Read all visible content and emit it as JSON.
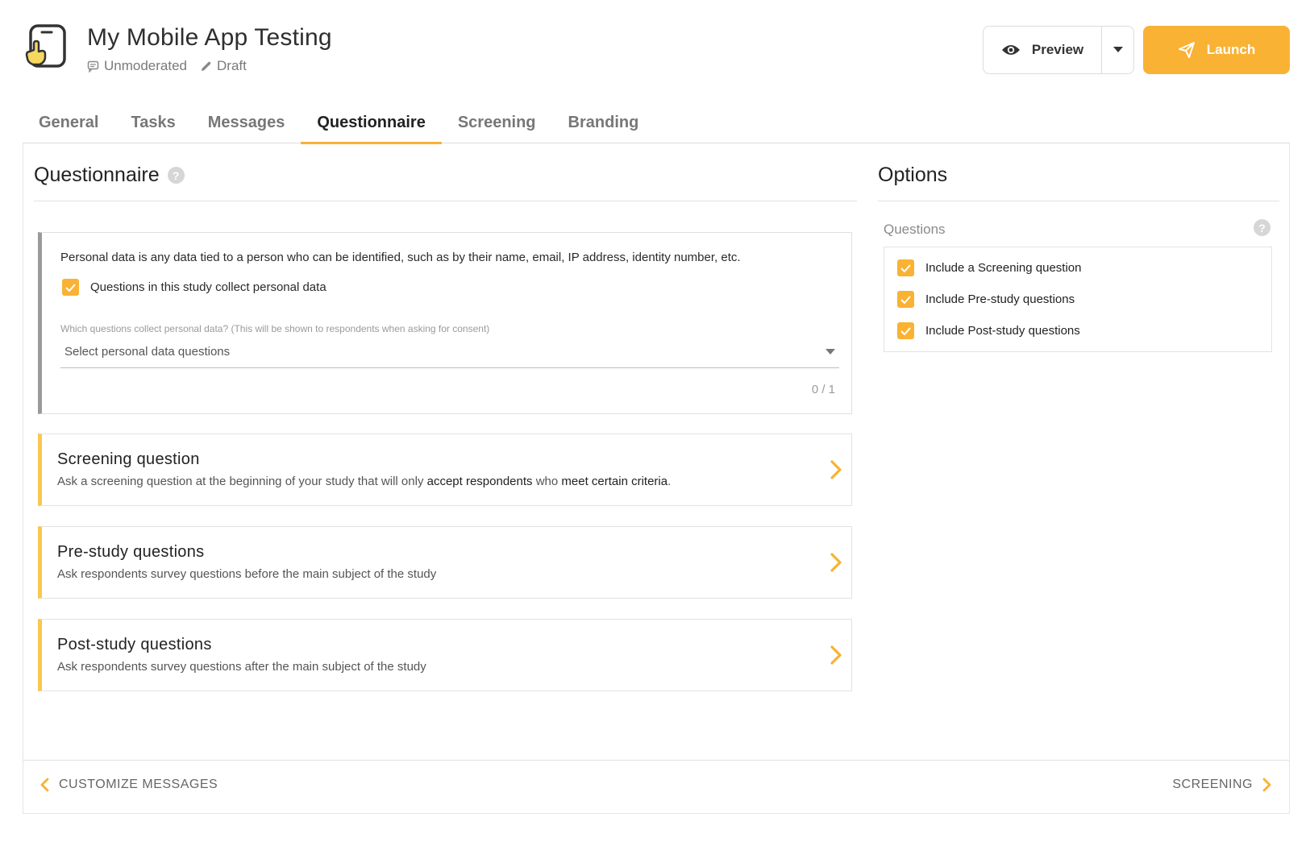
{
  "header": {
    "title": "My Mobile App Testing",
    "mode": "Unmoderated",
    "status": "Draft",
    "preview_label": "Preview",
    "launch_label": "Launch"
  },
  "tabs": [
    {
      "label": "General"
    },
    {
      "label": "Tasks"
    },
    {
      "label": "Messages"
    },
    {
      "label": "Questionnaire",
      "active": true
    },
    {
      "label": "Screening"
    },
    {
      "label": "Branding"
    }
  ],
  "questionnaire": {
    "title": "Questionnaire",
    "help": "?",
    "personal_data": {
      "text": "Personal data is any data tied to a person who can be identified, such as by their name, email, IP address, identity number, etc.",
      "checkbox_label": "Questions in this study collect personal data",
      "checked": true,
      "select_label": "Which questions collect personal data? (This will be shown to respondents when asking for consent)",
      "select_placeholder": "Select personal data questions",
      "counter": "0 / 1"
    },
    "sections": [
      {
        "title": "Screening question",
        "desc_pre": "Ask a screening question at the beginning of your study that will only ",
        "desc_em1": "accept respondents",
        "desc_mid": " who ",
        "desc_em2": "meet certain criteria",
        "desc_post": "."
      },
      {
        "title": "Pre-study questions",
        "desc": "Ask respondents survey questions before the main subject of the study"
      },
      {
        "title": "Post-study questions",
        "desc": "Ask respondents survey questions after the main subject of the study"
      }
    ]
  },
  "options": {
    "title": "Options",
    "questions_label": "Questions",
    "help": "?",
    "items": [
      {
        "label": "Include a Screening question",
        "checked": true
      },
      {
        "label": "Include Pre-study questions",
        "checked": true
      },
      {
        "label": "Include Post-study questions",
        "checked": true
      }
    ]
  },
  "footer": {
    "prev_label": "CUSTOMIZE MESSAGES",
    "next_label": "SCREENING"
  },
  "colors": {
    "accent": "#f9b233",
    "card_border": "#f9c851"
  }
}
